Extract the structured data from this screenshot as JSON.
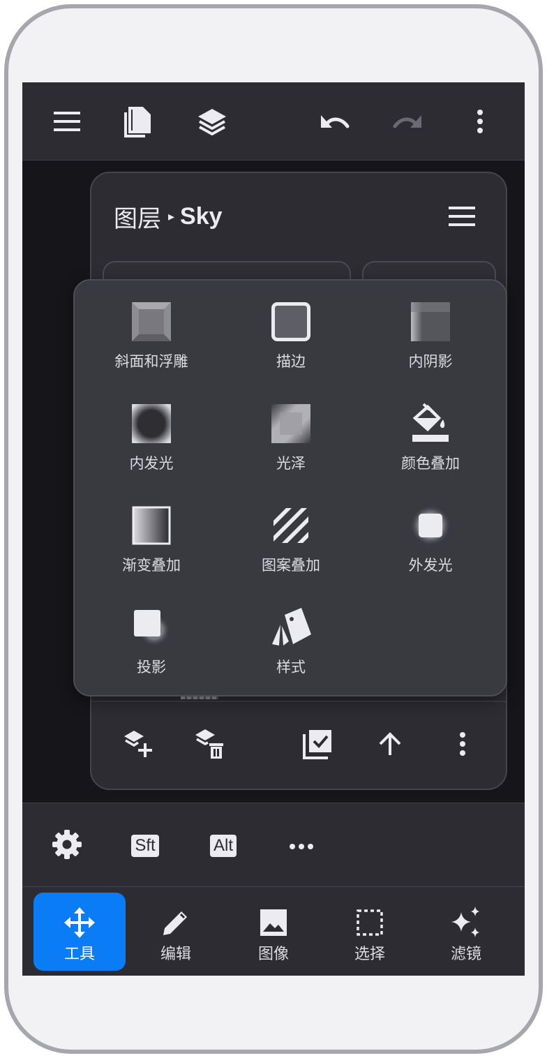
{
  "topbar": {
    "icons": [
      "menu-icon",
      "documents-icon",
      "layers-icon",
      "undo-icon",
      "redo-icon",
      "more-vert-icon"
    ]
  },
  "layers_panel": {
    "title": "图层",
    "separator": "▸",
    "current_layer": "Sky",
    "footer_icons": [
      "add-layer-icon",
      "delete-layer-icon",
      "merge-layer-icon",
      "move-up-icon",
      "more-vert-icon"
    ]
  },
  "layer_styles": {
    "items": [
      {
        "label": "斜面和浮雕",
        "icon": "bevel-emboss-icon"
      },
      {
        "label": "描边",
        "icon": "stroke-icon"
      },
      {
        "label": "内阴影",
        "icon": "inner-shadow-icon"
      },
      {
        "label": "内发光",
        "icon": "inner-glow-icon"
      },
      {
        "label": "光泽",
        "icon": "satin-icon"
      },
      {
        "label": "颜色叠加",
        "icon": "color-overlay-icon"
      },
      {
        "label": "渐变叠加",
        "icon": "gradient-overlay-icon"
      },
      {
        "label": "图案叠加",
        "icon": "pattern-overlay-icon"
      },
      {
        "label": "外发光",
        "icon": "outer-glow-icon"
      },
      {
        "label": "投影",
        "icon": "drop-shadow-icon"
      },
      {
        "label": "样式",
        "icon": "styles-icon"
      }
    ]
  },
  "modifier_bar": {
    "shift_label": "Sft",
    "alt_label": "Alt",
    "more_label": "•••"
  },
  "bottom_nav": {
    "items": [
      {
        "label": "工具",
        "icon": "move-icon",
        "active": true
      },
      {
        "label": "编辑",
        "icon": "pencil-icon",
        "active": false
      },
      {
        "label": "图像",
        "icon": "image-icon",
        "active": false
      },
      {
        "label": "选择",
        "icon": "selection-icon",
        "active": false
      },
      {
        "label": "滤镜",
        "icon": "sparkle-icon",
        "active": false
      }
    ]
  },
  "colors": {
    "accent": "#0a7cf5",
    "panel": "#2c2c32",
    "popup": "#393940",
    "icon": "#ececf0"
  }
}
